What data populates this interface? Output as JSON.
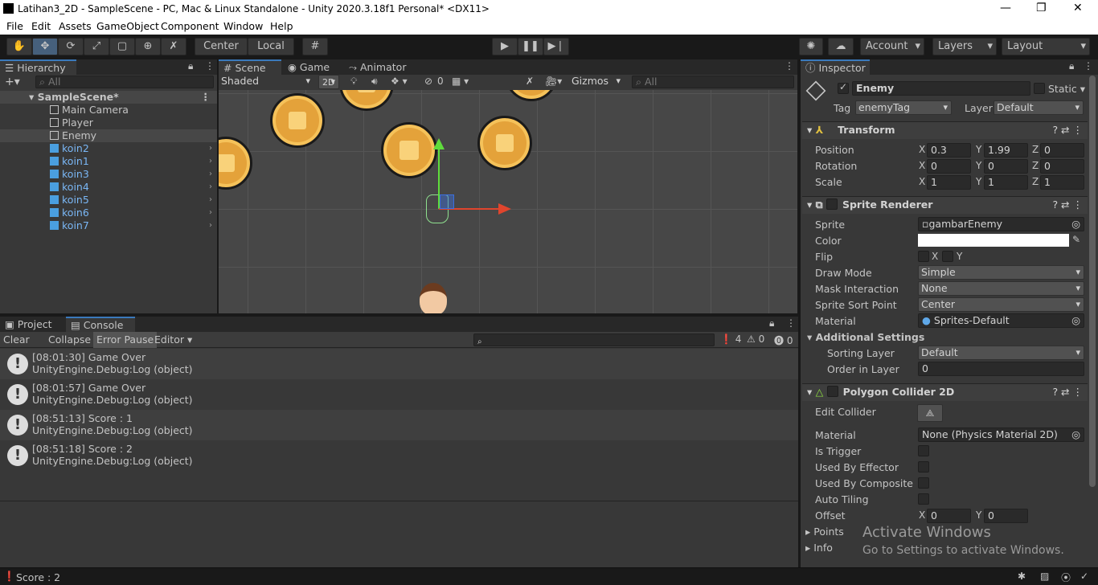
{
  "window": {
    "title": "Latihan3_2D - SampleScene - PC, Mac & Linux Standalone - Unity 2020.3.18f1 Personal* <DX11>"
  },
  "menu": [
    "File",
    "Edit",
    "Assets",
    "GameObject",
    "Component",
    "Window",
    "Help"
  ],
  "toolbar": {
    "pivot": "Center",
    "space": "Local",
    "account": "Account",
    "layers": "Layers",
    "layout": "Layout"
  },
  "hierarchy": {
    "tab": "Hierarchy",
    "search_placeholder": "All",
    "scene": "SampleScene*",
    "items": [
      {
        "name": "Main Camera",
        "prefab": false
      },
      {
        "name": "Player",
        "prefab": false
      },
      {
        "name": "Enemy",
        "prefab": false,
        "selected": true
      },
      {
        "name": "koin2",
        "prefab": true
      },
      {
        "name": "koin1",
        "prefab": true
      },
      {
        "name": "koin3",
        "prefab": true
      },
      {
        "name": "koin4",
        "prefab": true
      },
      {
        "name": "koin5",
        "prefab": true
      },
      {
        "name": "koin6",
        "prefab": true
      },
      {
        "name": "koin7",
        "prefab": true
      }
    ]
  },
  "scene_view": {
    "tabs": [
      "Scene",
      "Game",
      "Animator"
    ],
    "shading": "Shaded",
    "mode2d": "2D",
    "hidden_count": "0",
    "gizmos": "Gizmos",
    "search_placeholder": "All"
  },
  "console": {
    "tabs": [
      "Project",
      "Console"
    ],
    "buttons": [
      "Clear",
      "Collapse",
      "Error Pause",
      "Editor"
    ],
    "counts": {
      "log": "4",
      "warn": "0",
      "error": "0"
    },
    "logs": [
      {
        "line1": "[08:01:30] Game Over",
        "line2": "UnityEngine.Debug:Log (object)"
      },
      {
        "line1": "[08:01:57] Game Over",
        "line2": "UnityEngine.Debug:Log (object)"
      },
      {
        "line1": "[08:51:13] Score : 1",
        "line2": "UnityEngine.Debug:Log (object)"
      },
      {
        "line1": "[08:51:18] Score : 2",
        "line2": "UnityEngine.Debug:Log (object)"
      }
    ]
  },
  "inspector": {
    "tab": "Inspector",
    "object_name": "Enemy",
    "static": "Static",
    "tag_label": "Tag",
    "tag": "enemyTag",
    "layer_label": "Layer",
    "layer": "Default",
    "transform": {
      "title": "Transform",
      "position": {
        "label": "Position",
        "x": "0.3",
        "y": "1.99",
        "z": "0"
      },
      "rotation": {
        "label": "Rotation",
        "x": "0",
        "y": "0",
        "z": "0"
      },
      "scale": {
        "label": "Scale",
        "x": "1",
        "y": "1",
        "z": "1"
      }
    },
    "sprite_renderer": {
      "title": "Sprite Renderer",
      "sprite_label": "Sprite",
      "sprite": "gambarEnemy",
      "color_label": "Color",
      "flip_label": "Flip",
      "draw_mode_label": "Draw Mode",
      "draw_mode": "Simple",
      "mask_label": "Mask Interaction",
      "mask": "None",
      "sort_point_label": "Sprite Sort Point",
      "sort_point": "Center",
      "material_label": "Material",
      "material": "Sprites-Default",
      "additional": "Additional Settings",
      "sorting_layer_label": "Sorting Layer",
      "sorting_layer": "Default",
      "order_label": "Order in Layer",
      "order": "0"
    },
    "collider": {
      "title": "Polygon Collider 2D",
      "edit_label": "Edit Collider",
      "material_label": "Material",
      "material": "None (Physics Material 2D)",
      "is_trigger": "Is Trigger",
      "effector": "Used By Effector",
      "composite": "Used By Composite",
      "auto_tiling": "Auto Tiling",
      "offset_label": "Offset",
      "offset_x": "0",
      "offset_y": "0",
      "points": "Points",
      "info": "Info"
    },
    "watermark1": "Activate Windows",
    "watermark2": "Go to Settings to activate Windows."
  },
  "status": {
    "text": "Score : 2"
  }
}
